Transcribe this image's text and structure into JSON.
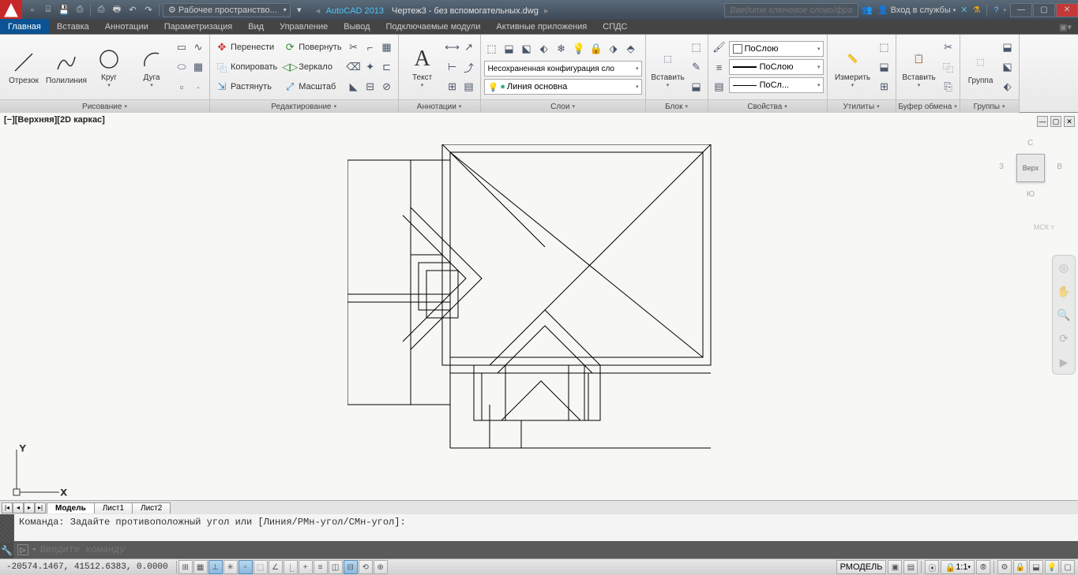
{
  "title": {
    "app": "AutoCAD 2013",
    "file": "Чертеж3 - без вспомогательных.dwg"
  },
  "workspace": "Рабочее пространство...",
  "search_placeholder": "Введите ключевое слово/фразу",
  "signin": "Вход в службы",
  "tabs": [
    "Главная",
    "Вставка",
    "Аннотации",
    "Параметризация",
    "Вид",
    "Управление",
    "Вывод",
    "Подключаемые модули",
    "Активные приложения",
    "СПДС"
  ],
  "panels": {
    "draw": {
      "title": "Рисование",
      "line": "Отрезок",
      "polyline": "Полилиния",
      "circle": "Круг",
      "arc": "Дуга"
    },
    "modify": {
      "title": "Редактирование",
      "move": "Перенести",
      "copy": "Копировать",
      "stretch": "Растянуть",
      "rotate": "Повернуть",
      "mirror": "Зеркало",
      "scale": "Масштаб"
    },
    "annot": {
      "title": "Аннотации",
      "text": "Текст"
    },
    "layers": {
      "title": "Слои",
      "config": "Несохраненная конфигурация сло",
      "current": "Линия основна"
    },
    "block": {
      "title": "Блок",
      "insert": "Вставить"
    },
    "props": {
      "title": "Свойства",
      "color": "ПоСлою",
      "lw": "ПоСлою",
      "lt": "ПоСл..."
    },
    "utils": {
      "title": "Утилиты",
      "measure": "Измерить"
    },
    "clip": {
      "title": "Буфер обмена",
      "paste": "Вставить"
    },
    "groups": {
      "title": "Группы",
      "group": "Группа"
    }
  },
  "view_label": "[−][Верхняя][2D каркас]",
  "viewcube": {
    "face": "Верх",
    "n": "С",
    "s": "Ю",
    "e": "В",
    "w": "З",
    "wcs": "МСК ▿"
  },
  "layout_tabs": [
    "Модель",
    "Лист1",
    "Лист2"
  ],
  "cmd_history": "Команда: Задайте противоположный угол или [Линия/РМн-угол/СМн-угол]:",
  "cmd_placeholder": "Введите команду",
  "status": {
    "coords": "-20574.1467, 41512.6383, 0.0000",
    "space": "РМОДЕЛЬ",
    "scale": "1:1"
  }
}
